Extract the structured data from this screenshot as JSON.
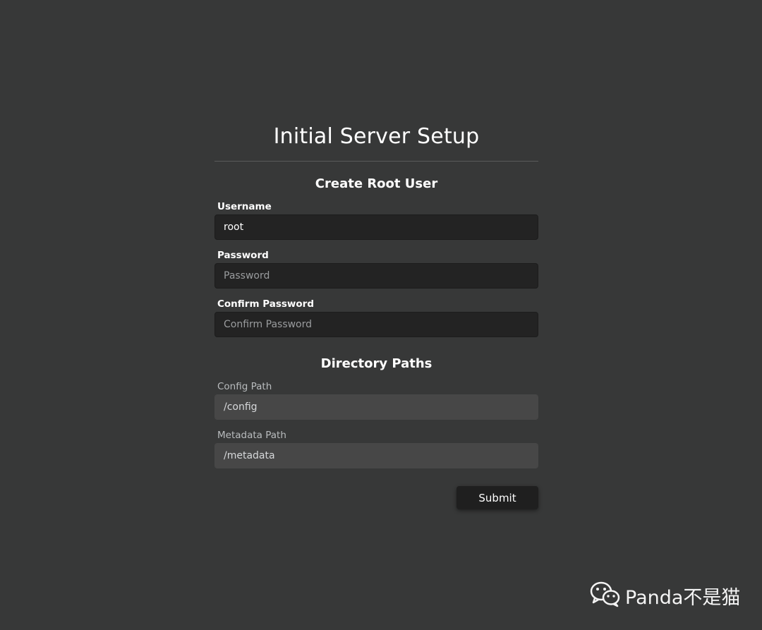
{
  "page": {
    "title": "Initial Server Setup"
  },
  "root_user": {
    "heading": "Create Root User",
    "username": {
      "label": "Username",
      "value": "root"
    },
    "password": {
      "label": "Password",
      "placeholder": "Password",
      "value": ""
    },
    "confirm_password": {
      "label": "Confirm Password",
      "placeholder": "Confirm Password",
      "value": ""
    }
  },
  "directories": {
    "heading": "Directory Paths",
    "config_path": {
      "label": "Config Path",
      "value": "/config"
    },
    "metadata_path": {
      "label": "Metadata Path",
      "value": "/metadata"
    }
  },
  "actions": {
    "submit_label": "Submit"
  },
  "watermark": {
    "icon": "wechat-icon",
    "text": "Panda不是猫"
  },
  "colors": {
    "background": "#373838",
    "input_bg": "#232323",
    "disabled_input_bg": "#474747",
    "button_bg": "#1f1f1f",
    "text": "#ffffff"
  }
}
